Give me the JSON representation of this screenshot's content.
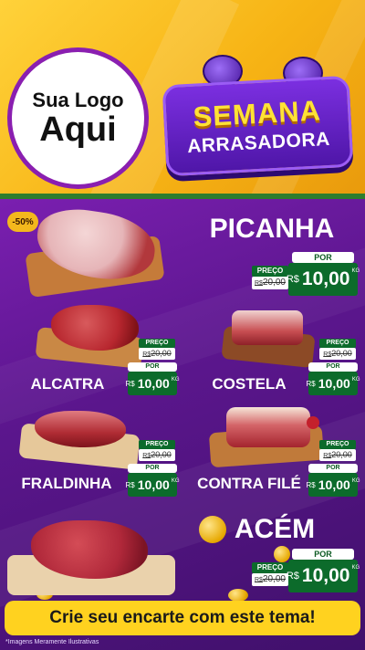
{
  "header": {
    "logo_line1": "Sua Logo",
    "logo_line2": "Aqui",
    "badge_line1": "SEMANA",
    "badge_line2": "ARRASADORA"
  },
  "discount": "-50%",
  "products": {
    "picanha": {
      "name": "PICANHA",
      "por": "POR",
      "preco": "PREÇO",
      "old": "20,00",
      "old_prefix": "R$",
      "currency": "R$",
      "price": "10,00",
      "unit": "KG"
    },
    "alcatra": {
      "name": "ALCATRA",
      "por": "POR",
      "preco": "PREÇO",
      "old": "20,00",
      "old_prefix": "R$",
      "currency": "R$",
      "price": "10,00",
      "unit": "KG"
    },
    "costela": {
      "name": "COSTELA",
      "por": "POR",
      "preco": "PREÇO",
      "old": "20,00",
      "old_prefix": "R$",
      "currency": "R$",
      "price": "10,00",
      "unit": "KG"
    },
    "fraldinha": {
      "name": "FRALDINHA",
      "por": "POR",
      "preco": "PREÇO",
      "old": "20,00",
      "old_prefix": "R$",
      "currency": "R$",
      "price": "10,00",
      "unit": "KG"
    },
    "contrafile": {
      "name": "CONTRA FILÉ",
      "por": "POR",
      "preco": "PREÇO",
      "old": "20,00",
      "old_prefix": "R$",
      "currency": "R$",
      "price": "10,00",
      "unit": "KG"
    },
    "acem": {
      "name": "ACÉM",
      "por": "POR",
      "preco": "PREÇO",
      "old": "20,00",
      "old_prefix": "R$",
      "currency": "R$",
      "price": "10,00",
      "unit": "KG"
    }
  },
  "cta": "Crie seu encarte com este tema!",
  "disclaimer": "*Imagens Meramente Ilustrativas",
  "colors": {
    "yellow": "#ffd21f",
    "purple": "#5b168d",
    "green": "#0c6b2b"
  }
}
